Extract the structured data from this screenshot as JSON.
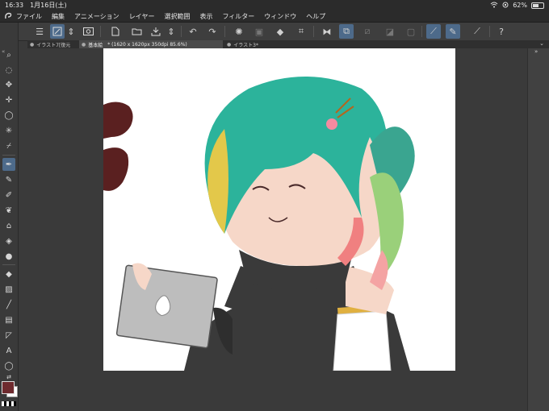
{
  "status": {
    "time": "16:33",
    "date": "1月16日(土)",
    "battery": "62%",
    "battery_level": 0.62
  },
  "menu": [
    "ファイル",
    "編集",
    "アニメーション",
    "レイヤー",
    "選択範囲",
    "表示",
    "フィルター",
    "ウィンドウ",
    "ヘルプ"
  ],
  "tabs": [
    {
      "label": "イラスト7[復元",
      "active": false
    },
    {
      "label": "基本絵",
      "active": true
    },
    {
      "label": "* (1620 x 1620px 350dpi 85.6%)",
      "active": true
    },
    {
      "label": "イラスト3*",
      "active": false
    }
  ],
  "colors": {
    "main": "#6e2a2e",
    "sub": "#ffffff",
    "accent": "#4d6a8a"
  },
  "icons": {
    "toolbar": [
      "menu-icon",
      "quick-access-icon",
      "stepper-icon",
      "eye-icon",
      "new-file-icon",
      "open-folder-icon",
      "save-icon",
      "print-icon",
      "stepper-icon",
      "undo-icon",
      "redo-icon",
      "loading-icon",
      "clear-icon",
      "fill-icon",
      "crop-icon",
      "flip-icon",
      "transform-icon",
      "reference-icon",
      "grid-icon",
      "ruler-icon",
      "stabilizer-icon",
      "pen-settings-icon",
      "vector-icon",
      "help-icon"
    ],
    "tools": [
      "zoom-icon",
      "lasso-icon",
      "select-icon",
      "move-icon",
      "loupe-icon",
      "magic-wand-icon",
      "eyedropper-icon",
      "pen-icon",
      "pencil-icon",
      "brush-icon",
      "airbrush-icon",
      "decoration-icon",
      "eraser-icon",
      "blend-icon",
      "fill-bucket-icon",
      "gradient-icon",
      "line-icon",
      "frame-icon",
      "ruler-tool-icon",
      "text-icon",
      "balloon-icon",
      "color-swap-icon"
    ]
  }
}
